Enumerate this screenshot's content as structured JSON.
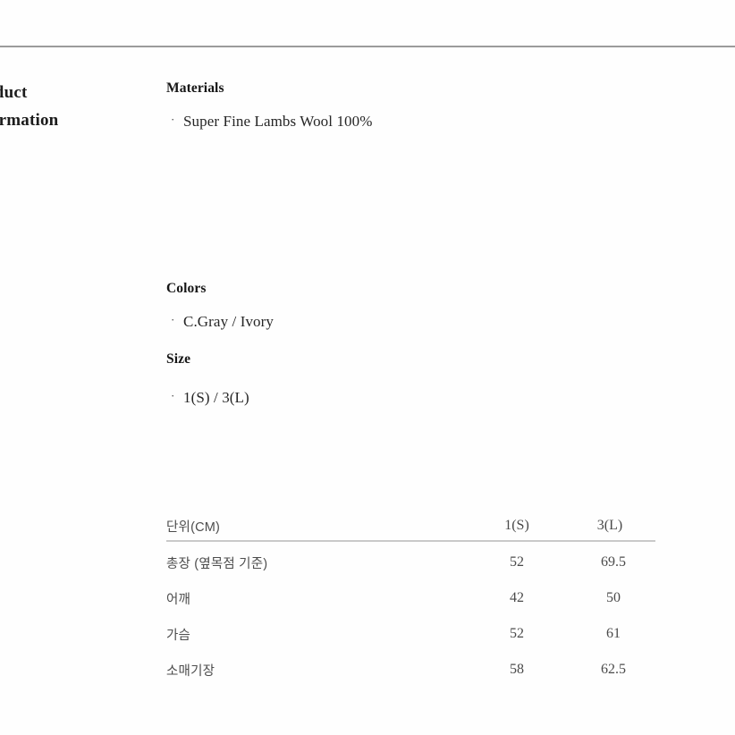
{
  "page": {
    "side_title_line1": "Product",
    "side_title_line2": "Information"
  },
  "sections": {
    "materials": {
      "heading": "Materials",
      "bullet": "·",
      "item": "Super Fine Lambs Wool 100%"
    },
    "colors": {
      "heading": "Colors",
      "bullet": "·",
      "item": "C.Gray / Ivory"
    },
    "size": {
      "heading": "Size",
      "bullet": "·",
      "item": "1(S) / 3(L)"
    }
  },
  "size_table": {
    "headers": [
      "단위(CM)",
      "1(S)",
      "3(L)"
    ],
    "rows": [
      {
        "label": "총장 (옆목점 기준)",
        "s": "52",
        "l": "69.5"
      },
      {
        "label": "어깨",
        "s": "42",
        "l": "50"
      },
      {
        "label": "가슴",
        "s": "52",
        "l": "61"
      },
      {
        "label": "소매기장",
        "s": "58",
        "l": "62.5"
      }
    ]
  },
  "colors": {
    "background": "#fefefe",
    "text_dark": "#1c1c1c",
    "text_body": "#262626",
    "text_table": "#4a4a4a",
    "rule_top": "#9b9b9b",
    "rule_table": "#c9c9c9"
  }
}
